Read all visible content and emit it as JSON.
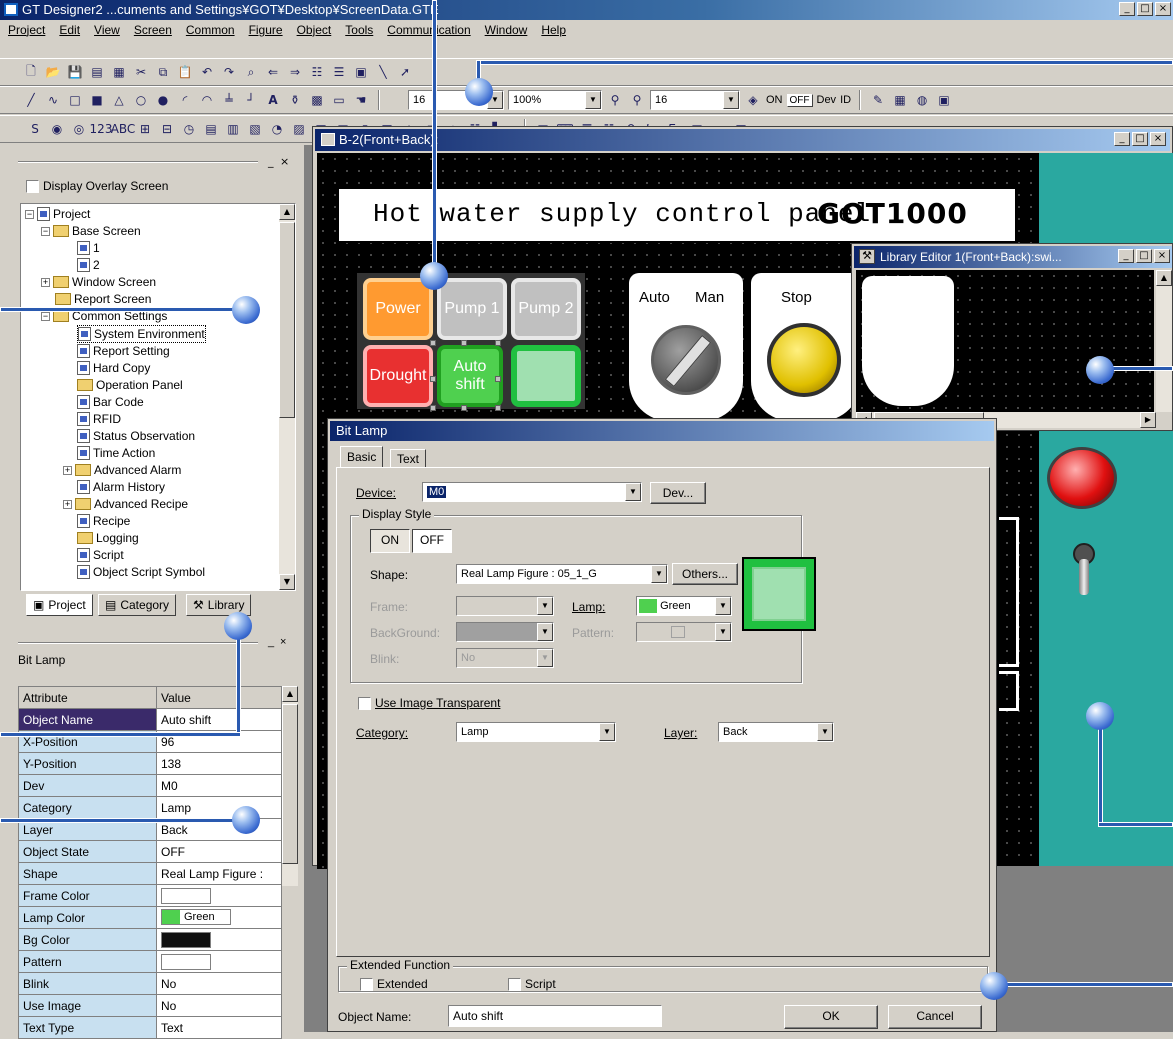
{
  "app": {
    "title": "GT Designer2 ...cuments and Settings¥GOT¥Desktop¥ScreenData.GTE",
    "menus": [
      "Project",
      "Edit",
      "View",
      "Screen",
      "Common",
      "Figure",
      "Object",
      "Tools",
      "Communication",
      "Window",
      "Help"
    ]
  },
  "toolbar": {
    "font_size": "16",
    "zoom": "100%",
    "text_size": "16",
    "on_label": "ON",
    "off_label": "OFF",
    "dev_label": "Dev",
    "id_label": "ID"
  },
  "workspace": {
    "overlay_label": "Display Overlay Screen",
    "tree": [
      {
        "label": "Project",
        "icon": "project-icon"
      },
      {
        "label": "Base Screen",
        "icon": "folder-icon"
      },
      {
        "label": "1",
        "icon": "screen-icon"
      },
      {
        "label": "2",
        "icon": "screen-icon"
      },
      {
        "label": "Window Screen",
        "icon": "folder-icon"
      },
      {
        "label": "Report Screen",
        "icon": "folder-icon"
      },
      {
        "label": "Common Settings",
        "icon": "folder-icon"
      },
      {
        "label": "System Environment",
        "icon": "system-icon"
      },
      {
        "label": "Report Setting",
        "icon": "report-icon"
      },
      {
        "label": "Hard Copy",
        "icon": "printer-icon"
      },
      {
        "label": "Operation Panel",
        "icon": "folder-icon"
      },
      {
        "label": "Bar Code",
        "icon": "barcode-icon"
      },
      {
        "label": "RFID",
        "icon": "rfid-icon"
      },
      {
        "label": "Status Observation",
        "icon": "status-icon"
      },
      {
        "label": "Time Action",
        "icon": "clock-icon"
      },
      {
        "label": "Advanced Alarm",
        "icon": "folder-icon"
      },
      {
        "label": "Alarm History",
        "icon": "alarm-icon"
      },
      {
        "label": "Advanced Recipe",
        "icon": "folder-icon"
      },
      {
        "label": "Recipe",
        "icon": "recipe-icon"
      },
      {
        "label": "Logging",
        "icon": "folder-icon"
      },
      {
        "label": "Script",
        "icon": "script-icon"
      },
      {
        "label": "Object Script Symbol",
        "icon": "script-icon"
      }
    ],
    "tabs": [
      "Project",
      "Category",
      "Library"
    ]
  },
  "properties": {
    "title": "Bit Lamp",
    "header": {
      "attribute": "Attribute",
      "value": "Value"
    },
    "rows": [
      {
        "name": "Object Name",
        "value": "Auto shift"
      },
      {
        "name": "X-Position",
        "value": "96"
      },
      {
        "name": "Y-Position",
        "value": "138"
      },
      {
        "name": "Dev",
        "value": "M0"
      },
      {
        "name": "Category",
        "value": "Lamp"
      },
      {
        "name": "Layer",
        "value": "Back"
      },
      {
        "name": "Object State",
        "value": "OFF"
      },
      {
        "name": "Shape",
        "value": "Real Lamp Figure :"
      },
      {
        "name": "Frame Color",
        "value": ""
      },
      {
        "name": "Lamp Color",
        "value": "Green"
      },
      {
        "name": "Bg Color",
        "value": ""
      },
      {
        "name": "Pattern",
        "value": ""
      },
      {
        "name": "Blink",
        "value": "No"
      },
      {
        "name": "Use Image",
        "value": "No"
      },
      {
        "name": "Text Type",
        "value": "Text"
      }
    ]
  },
  "screen": {
    "title": "B-2(Front+Back):",
    "panel_title": "Hot water supply control panel",
    "brand": "GOT1000",
    "keys": [
      "Power",
      "Pump 1",
      "Pump 2",
      "Drought",
      "Auto shift",
      ""
    ],
    "selector": {
      "auto": "Auto",
      "man": "Man"
    },
    "stop_label": "Stop"
  },
  "library": {
    "title": "Library Editor 1(Front+Back):swi..."
  },
  "dialog": {
    "title": "Bit Lamp",
    "tabs": [
      "Basic",
      "Text"
    ],
    "device_label": "Device:",
    "device_value": "M0",
    "dev_button": "Dev...",
    "display_style": "Display Style",
    "on": "ON",
    "off": "OFF",
    "shape_label": "Shape:",
    "shape_value": "Real Lamp Figure : 05_1_G",
    "others_button": "Others...",
    "frame_label": "Frame:",
    "lamp_label": "Lamp:",
    "lamp_value": "Green",
    "background_label": "BackGround:",
    "pattern_label": "Pattern:",
    "blink_label": "Blink:",
    "blink_value": "No",
    "use_image": "Use Image Transparent",
    "category_label": "Category:",
    "category_value": "Lamp",
    "layer_label": "Layer:",
    "layer_value": "Back",
    "extended_function": "Extended Function",
    "extended": "Extended",
    "script": "Script",
    "object_name_label": "Object Name:",
    "object_name_value": "Auto shift",
    "ok": "OK",
    "cancel": "Cancel"
  },
  "colors": {
    "lamp_green": "#4fd04f",
    "teal_bg": "#2aa8a0",
    "title_blue": "#0a246a"
  }
}
